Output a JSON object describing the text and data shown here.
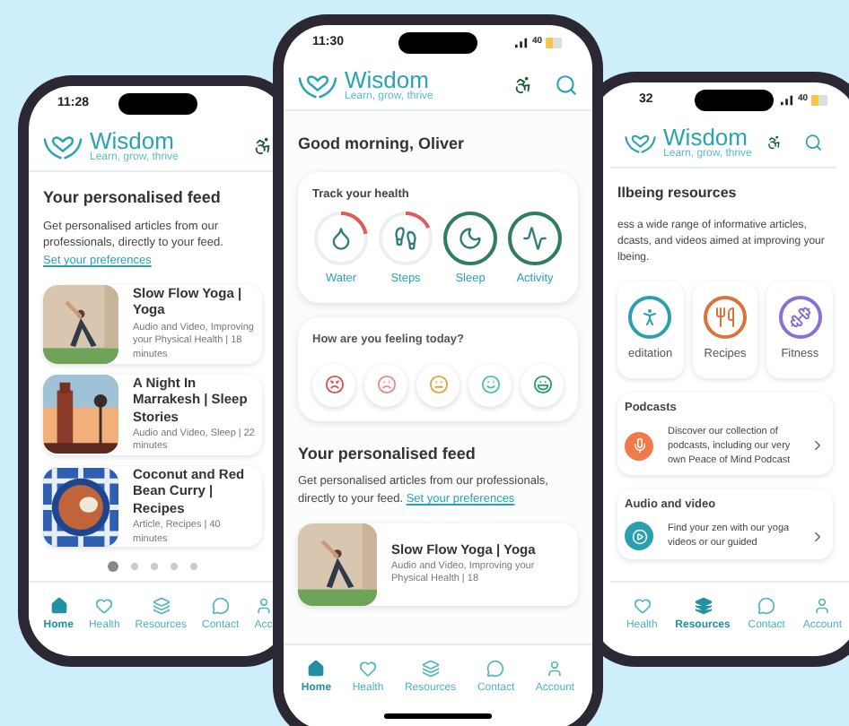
{
  "left_phone": {
    "time": "11:28",
    "brand": "Wisdom",
    "tagline": "Learn, grow, thrive",
    "feed_title": "Your personalised feed",
    "feed_text": "Get personalised articles from our professionals, directly to your feed.",
    "feed_link": "Set your preferences",
    "articles": [
      {
        "title": "Slow Flow Yoga | Yoga",
        "meta": "Audio and Video, Improving your Physical Health | 18 minutes"
      },
      {
        "title": "A Night In Marrakesh | Sleep Stories",
        "meta": "Audio and Video, Sleep | 22 minutes"
      },
      {
        "title": "Coconut and Red Bean Curry | Recipes",
        "meta": "Article, Recipes | 40 minutes"
      }
    ],
    "dots": [
      {
        "selected": true
      },
      {
        "selected": false
      },
      {
        "selected": false
      },
      {
        "selected": false
      },
      {
        "selected": false
      }
    ],
    "nav": [
      {
        "label": "Home",
        "selected": true
      },
      {
        "label": "Health",
        "selected": false
      },
      {
        "label": "Resources",
        "selected": false
      },
      {
        "label": "Contact",
        "selected": false
      },
      {
        "label": "Acc",
        "selected": false
      }
    ]
  },
  "center_phone": {
    "time": "11:30",
    "battery": "40",
    "brand": "Wisdom",
    "tagline": "Learn, grow, thrive",
    "greeting": "Good morning, Oliver",
    "track_title": "Track your health",
    "trackers": [
      {
        "label": "Water",
        "level": 0.22,
        "color": "#e05a5a"
      },
      {
        "label": "Steps",
        "level": 0.18,
        "color": "#e05a5a"
      },
      {
        "label": "Sleep",
        "level": 1,
        "color": "#2e7d5b"
      },
      {
        "label": "Activity",
        "level": 1,
        "color": "#2e7d5b"
      }
    ],
    "mood_title": "How are you feeling today?",
    "moods": [
      {
        "color": "#d9534f"
      },
      {
        "color": "#e88a8a"
      },
      {
        "color": "#e8a23a"
      },
      {
        "color": "#4fc3a1"
      },
      {
        "color": "#2e9e6e"
      }
    ],
    "feed_title": "Your personalised feed",
    "feed_text": "Get personalised articles from our professionals, directly to your feed.",
    "feed_link": "Set your preferences",
    "articles": [
      {
        "title": "Slow Flow Yoga | Yoga",
        "meta": "Audio and Video, Improving your Physical Health | 18"
      }
    ],
    "nav": [
      {
        "label": "Home",
        "selected": true
      },
      {
        "label": "Health",
        "selected": false
      },
      {
        "label": "Resources",
        "selected": false
      },
      {
        "label": "Contact",
        "selected": false
      },
      {
        "label": "Account",
        "selected": false
      }
    ]
  },
  "right_phone": {
    "time": "32",
    "battery": "40",
    "brand": "Wisdom",
    "tagline": "Learn, grow, thrive",
    "title": "llbeing resources",
    "text": "ess a wide range of informative articles, dcasts, and videos aimed at improving your lbeing.",
    "categories": [
      {
        "label": "editation",
        "color": "#2a9fb0"
      },
      {
        "label": "Recipes",
        "color": "#d9733a"
      },
      {
        "label": "Fitness",
        "color": "#8a6fd6"
      }
    ],
    "cards": [
      {
        "title": "Podcasts",
        "text": "Discover our collection of podcasts, including our very own Peace of Mind Podcast",
        "color": "#f07a4a"
      },
      {
        "title": "Audio and video",
        "text": "Find your zen with our yoga videos or our guided",
        "color": "#2a9fb0"
      }
    ],
    "nav": [
      {
        "label": "Health",
        "selected": false
      },
      {
        "label": "Resources",
        "selected": true
      },
      {
        "label": "Contact",
        "selected": false
      },
      {
        "label": "Account",
        "selected": false
      }
    ]
  }
}
